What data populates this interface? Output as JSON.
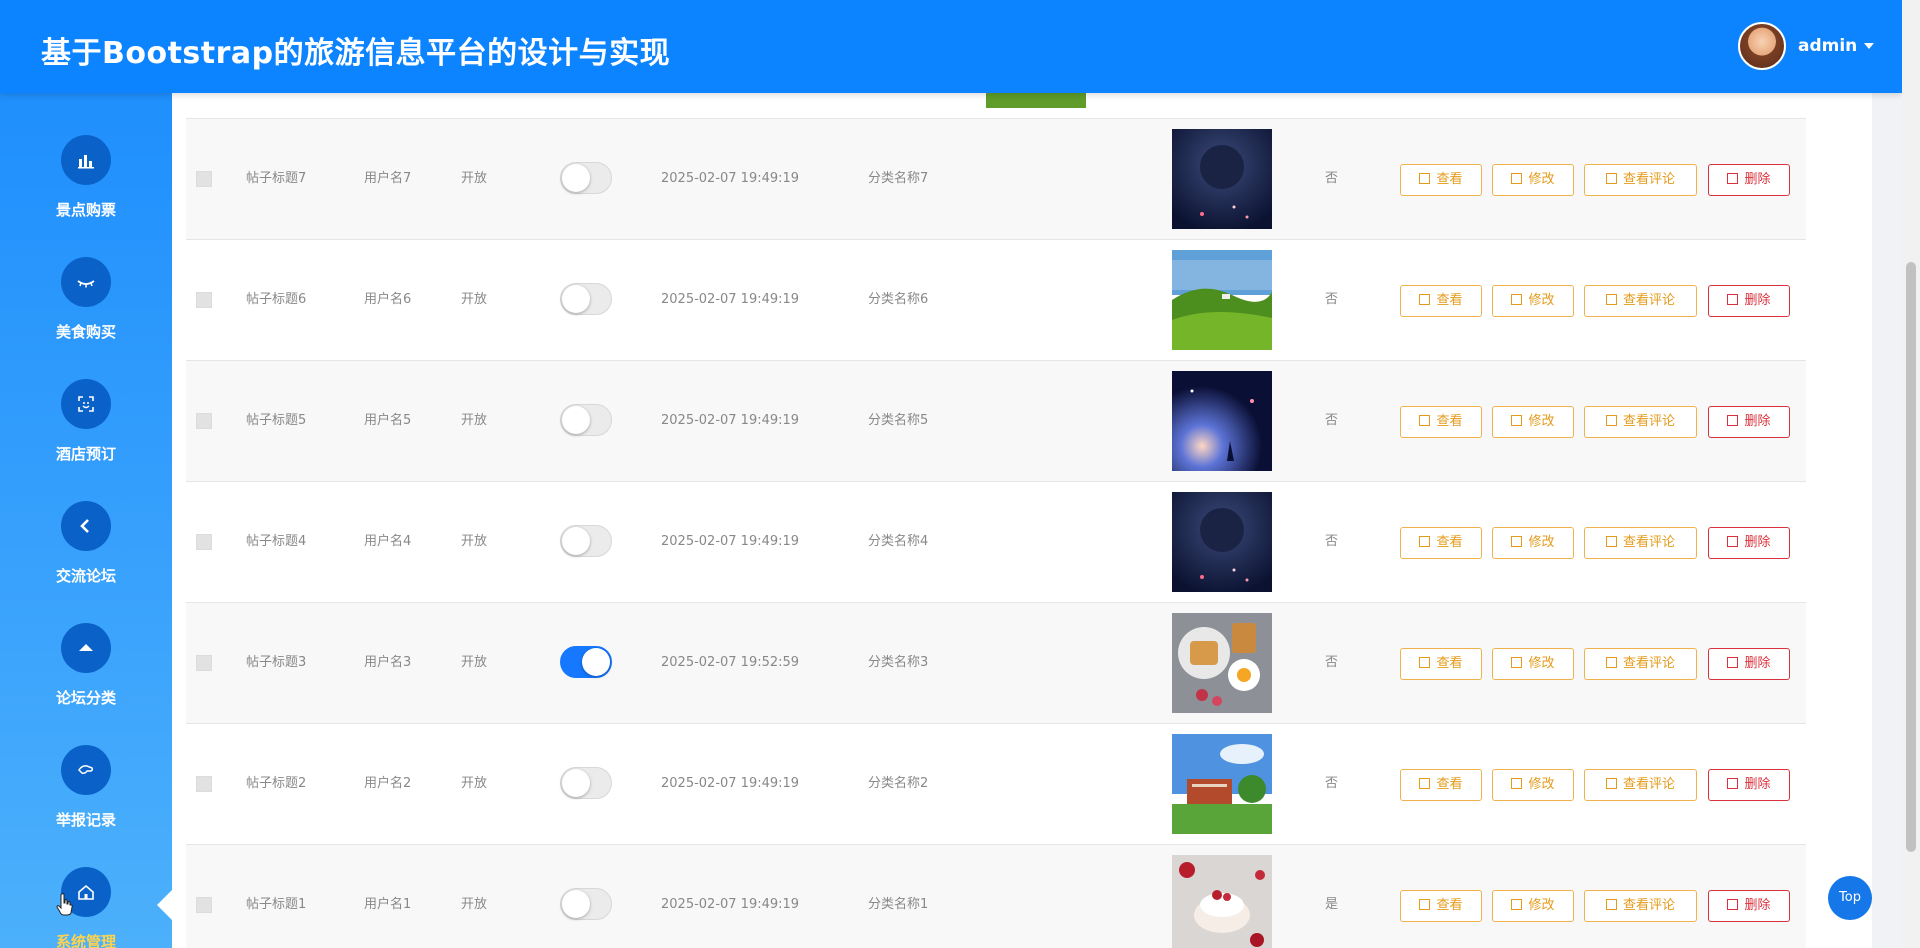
{
  "header": {
    "title": "基于Bootstrap的旅游信息平台的设计与实现",
    "user": "admin"
  },
  "sidebar": {
    "items": [
      {
        "label": "景点购票",
        "icon": "bar-chart-icon"
      },
      {
        "label": "美食购买",
        "icon": "eye-closed-icon"
      },
      {
        "label": "酒店预订",
        "icon": "face-scan-icon"
      },
      {
        "label": "交流论坛",
        "icon": "chevron-left-icon"
      },
      {
        "label": "论坛分类",
        "icon": "triangle-up-icon"
      },
      {
        "label": "举报记录",
        "icon": "hand-icon"
      },
      {
        "label": "系统管理",
        "icon": "home-icon",
        "active": true
      }
    ]
  },
  "table": {
    "buttons": {
      "view": "查看",
      "edit": "修改",
      "comments": "查看评论",
      "delete": "删除"
    },
    "rows": [
      {
        "title": "帖子标题7",
        "user": "用户名7",
        "status": "开放",
        "toggle": false,
        "time": "2025-02-07 19:49:19",
        "category": "分类名称7",
        "image": "night-dark",
        "flag": "否"
      },
      {
        "title": "帖子标题6",
        "user": "用户名6",
        "status": "开放",
        "toggle": false,
        "time": "2025-02-07 19:49:19",
        "category": "分类名称6",
        "image": "green-hills",
        "flag": "否"
      },
      {
        "title": "帖子标题5",
        "user": "用户名5",
        "status": "开放",
        "toggle": false,
        "time": "2025-02-07 19:49:19",
        "category": "分类名称5",
        "image": "night-glow",
        "flag": "否"
      },
      {
        "title": "帖子标题4",
        "user": "用户名4",
        "status": "开放",
        "toggle": false,
        "time": "2025-02-07 19:49:19",
        "category": "分类名称4",
        "image": "night-dark",
        "flag": "否"
      },
      {
        "title": "帖子标题3",
        "user": "用户名3",
        "status": "开放",
        "toggle": true,
        "time": "2025-02-07 19:52:59",
        "category": "分类名称3",
        "image": "breakfast",
        "flag": "否"
      },
      {
        "title": "帖子标题2",
        "user": "用户名2",
        "status": "开放",
        "toggle": false,
        "time": "2025-02-07 19:49:19",
        "category": "分类名称2",
        "image": "campus",
        "flag": "否"
      },
      {
        "title": "帖子标题1",
        "user": "用户名1",
        "status": "开放",
        "toggle": false,
        "time": "2025-02-07 19:49:19",
        "category": "分类名称1",
        "image": "dessert",
        "flag": "是"
      }
    ]
  },
  "top_button": "Top",
  "colors": {
    "header": "#0d84ff",
    "accent_active": "#ffd34d",
    "button_warning": "#e49b1b",
    "button_danger": "#d9323c",
    "toggle_on": "#1677ff"
  }
}
